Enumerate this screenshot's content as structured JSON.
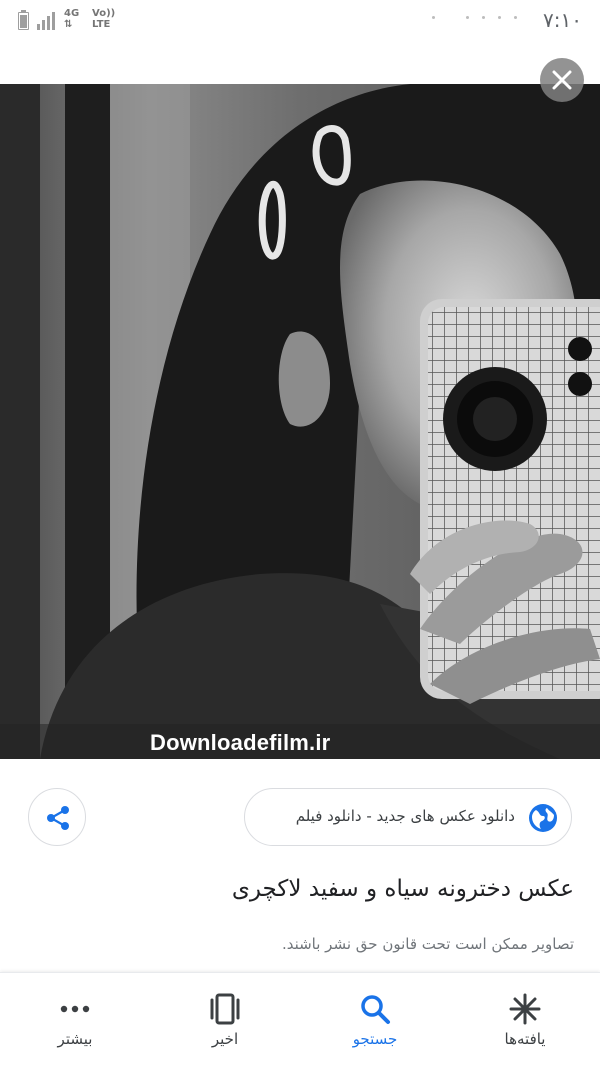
{
  "status_bar": {
    "network": "4G",
    "volte": "Vo)) LTE",
    "time": "۷:۱۰"
  },
  "image": {
    "watermark": "Downloadefilm.ir",
    "close_icon": "close-icon"
  },
  "result": {
    "source": "دانلود عکس های جدید - دانلود فیلم",
    "title": "عکس دخترونه سیاه و سفید لاکچری",
    "notice": "تصاویر ممکن است تحت قانون حق نشر باشند."
  },
  "bottom_nav": {
    "items": [
      {
        "label": "یافته‌ها",
        "icon": "asterisk-icon"
      },
      {
        "label": "جستجو",
        "icon": "search-icon"
      },
      {
        "label": "اخیر",
        "icon": "recent-tabs-icon"
      },
      {
        "label": "بیشتر",
        "icon": "more-dots-icon"
      }
    ],
    "active_index": 1,
    "accent": "#1a73e8"
  }
}
